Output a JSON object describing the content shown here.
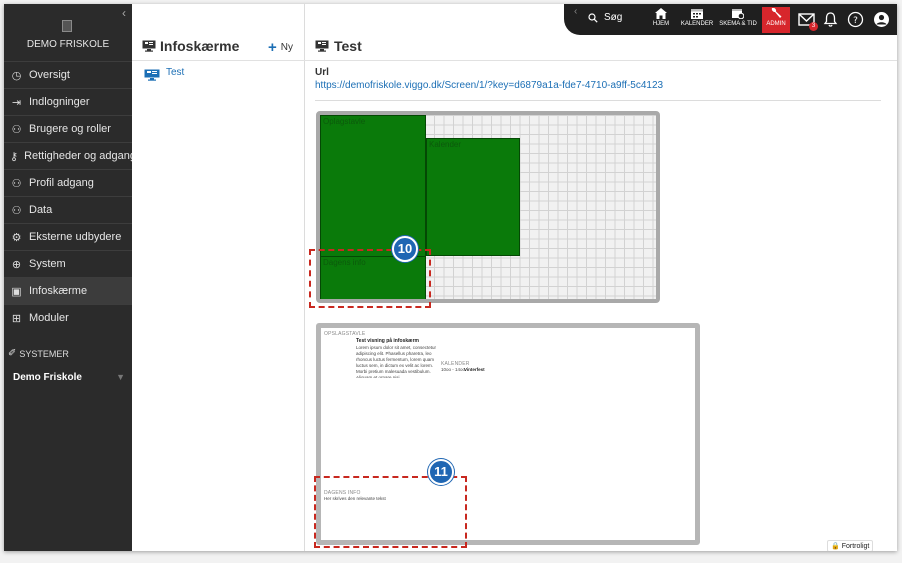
{
  "sidebar": {
    "school_name": "DEMO FRISKOLE",
    "menu": [
      {
        "label": "Oversigt",
        "icon": "dashboard-icon",
        "glyph": "◷"
      },
      {
        "label": "Indlogninger",
        "icon": "login-icon",
        "glyph": "⇥"
      },
      {
        "label": "Brugere og roller",
        "icon": "users-icon",
        "glyph": "⚇"
      },
      {
        "label": "Rettigheder og adgang",
        "icon": "key-icon",
        "glyph": "⚷"
      },
      {
        "label": "Profil adgang",
        "icon": "profile-access-icon",
        "glyph": "⚇"
      },
      {
        "label": "Data",
        "icon": "data-icon",
        "glyph": "⚇"
      },
      {
        "label": "Eksterne udbydere",
        "icon": "external-providers-icon",
        "glyph": "⚙"
      },
      {
        "label": "System",
        "icon": "globe-icon",
        "glyph": "⊕"
      },
      {
        "label": "Infoskærme",
        "icon": "monitor-icon",
        "glyph": "▣"
      },
      {
        "label": "Moduler",
        "icon": "modules-icon",
        "glyph": "⊞"
      }
    ],
    "active_index": 8,
    "systems_heading": "SYSTEMER",
    "systems_icon": "plug-icon",
    "organization": "Demo Friskole"
  },
  "list": {
    "title": "Infoskærme",
    "new_label": "Ny",
    "items": [
      {
        "label": "Test"
      }
    ]
  },
  "topbar": {
    "search_label": "Søg",
    "buttons": [
      {
        "label": "HJEM",
        "icon": "home-icon"
      },
      {
        "label": "KALENDER",
        "icon": "calendar-icon"
      },
      {
        "label": "SKEMA & TID",
        "icon": "schedule-icon"
      },
      {
        "label": "ADMIN",
        "icon": "wrench-icon"
      }
    ],
    "message_badge": "3",
    "icons": [
      "mail-icon",
      "bell-icon",
      "help-icon",
      "user-icon"
    ]
  },
  "detail": {
    "title": "Test",
    "url_label": "Url",
    "url": "https://demofriskole.viggo.dk/Screen/1/?key=d6879a1a-fde7-4710-a9ff-5c4123"
  },
  "screen_preview": {
    "zone_labels": [
      "Oplagstavle",
      "Kalender",
      "Dagens info"
    ],
    "layout_heading": "OPSLAGSTAVLE",
    "post_title": "Test visning på infoskærm",
    "post_body": "Lorem ipsum dolor sit amet, consectetur adipiscing elit. Phasellus pharetra, leo rhoncus luctus fermentum, lorem quam luctus sem, in dictum ex velit ac lorem. Morbi pretium malesuada vestibulum. Aliquam et ornare nisi.",
    "calendar_heading": "KALENDER",
    "calendar_time": "10oo - 14oo",
    "calendar_event": "Vinterfest",
    "info_heading": "DAGENS INFO",
    "info_text": "Her skrives den relevante tekst"
  },
  "callouts": [
    "10",
    "11"
  ],
  "footer_badge": "Fortroligt",
  "colors": {
    "sidebar_bg": "#2b2b2b",
    "topbar_bg": "#1f1f1f",
    "admin_red": "#d7262c",
    "link_blue": "#1c6fb5",
    "zone_green": "#0a7a0a",
    "callout_blue": "#1f66b3",
    "dash_red": "#c8281f"
  }
}
